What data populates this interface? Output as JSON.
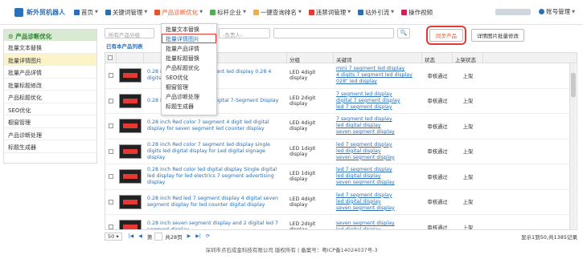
{
  "app": {
    "title": "新外贸机器人"
  },
  "nav": [
    {
      "label": "首页",
      "icon": "home-icon",
      "color": "#2a6fb8",
      "caret": true,
      "active": false
    },
    {
      "label": "关键词管理",
      "icon": "list-icon",
      "color": "#2a6fb8",
      "caret": true,
      "active": false
    },
    {
      "label": "产品诊断优化",
      "icon": "hand-icon",
      "color": "#e4572e",
      "caret": true,
      "active": true
    },
    {
      "label": "标杆企业",
      "icon": "flag-icon",
      "color": "#4caf50",
      "caret": true,
      "active": false
    },
    {
      "label": "一键查询排名",
      "icon": "search-icon",
      "color": "#f0ad4e",
      "caret": true,
      "active": false
    },
    {
      "label": "违禁词管理",
      "icon": "ban-icon",
      "color": "#e53935",
      "caret": true,
      "active": false
    },
    {
      "label": "站外引流",
      "icon": "chart-icon",
      "color": "#2a6fb8",
      "caret": true,
      "active": false
    },
    {
      "label": "操作视频",
      "icon": "video-icon",
      "color": "#d81b60",
      "caret": false,
      "active": false
    }
  ],
  "user": {
    "account_label": "账号管理"
  },
  "sidebar": {
    "title": "产品诊断优化",
    "items": [
      "批量文本替换",
      "批量详情图片",
      "批量产品详情",
      "批量标题修改",
      "产品标题优化",
      "SEO优化",
      "橱窗管理",
      "产品诊断处理",
      "标题生成器"
    ],
    "selected": 1
  },
  "dropdown": {
    "items": [
      "批量文本替换",
      "批量详情图片",
      "批量产品详情",
      "批量标题替换",
      "产品标题优化",
      "SEO优化",
      "橱窗管理",
      "产品诊断处理",
      "标题生成器"
    ],
    "highlighted": 1
  },
  "filter": {
    "category_placeholder": "所有产品分组",
    "owner_placeholder": "-负责人-"
  },
  "buttons": {
    "sync": "同步产品",
    "batch": "详情图片批量修改"
  },
  "count_label": "已有本产品列表",
  "table": {
    "headers": [
      "",
      "",
      "",
      "分组",
      "关键词",
      "状态",
      "上架状态"
    ],
    "rows": [
      {
        "title": "0.28 inch Red color 7 segment led display 0.28 4 digits 7 segment…",
        "group": "LED 4digit display",
        "keywords": [
          "mini 7 segment led display",
          "4 digits 7 segment led display",
          "028\" led display"
        ],
        "status": "审核通过",
        "shelf": "上架"
      },
      {
        "title": "0.28 inch Red Sign LED 2 Digital 7-Segment Display",
        "group": "LED 2digit display",
        "keywords": [
          "7 segment led display",
          "digital 7 segment display",
          "led 7 segment display"
        ],
        "status": "审核通过",
        "shelf": "上架"
      },
      {
        "title": "0.28 inch Red color 7 segment 4 digit led digital display for seven segment led counter display",
        "group": "LED 4digit display",
        "keywords": [
          "7 segment led display",
          "led digital display",
          "seven segment display"
        ],
        "status": "审核通过",
        "shelf": "上架"
      },
      {
        "title": "0.28 inch Red color 7 segment led display single digits led digital display for Led digital signage display",
        "group": "LED 1digit display",
        "keywords": [
          "led 7 segment display",
          "led digital display",
          "seven segment display"
        ],
        "status": "审核通过",
        "shelf": "上架"
      },
      {
        "title": "0.28 inch Red color led digital display Single digital led display for led electrics 7 segment advertising display",
        "group": "LED 1digit display",
        "keywords": [
          "led 7 segment display",
          "led digital display",
          "seven segment display"
        ],
        "status": "审核通过",
        "shelf": "上架"
      },
      {
        "title": "0.28 inch Red led 7 segment display 4 digital seven segment display for led counter digital display",
        "group": "LED 4digit display",
        "keywords": [
          "led 7 segment display",
          "led digital display",
          "seven segment display"
        ],
        "status": "审核通过",
        "shelf": "上架"
      },
      {
        "title": "0.28 inch seven segment display and 2 digital led 7 segment display…",
        "group": "LED 2digit display",
        "keywords": [
          "seven segment display",
          "led digital display"
        ],
        "status": "审核通过",
        "shelf": "上架"
      }
    ]
  },
  "pager": {
    "page_size": "50",
    "page_prefix": "第",
    "page_value": "1",
    "page_suffix": "共28页",
    "summary": "显示1到50,共1385记录"
  },
  "footer": "深圳市点石成金科技有限公司 版权所有 | 备案号：粤ICP备14024037号-3"
}
